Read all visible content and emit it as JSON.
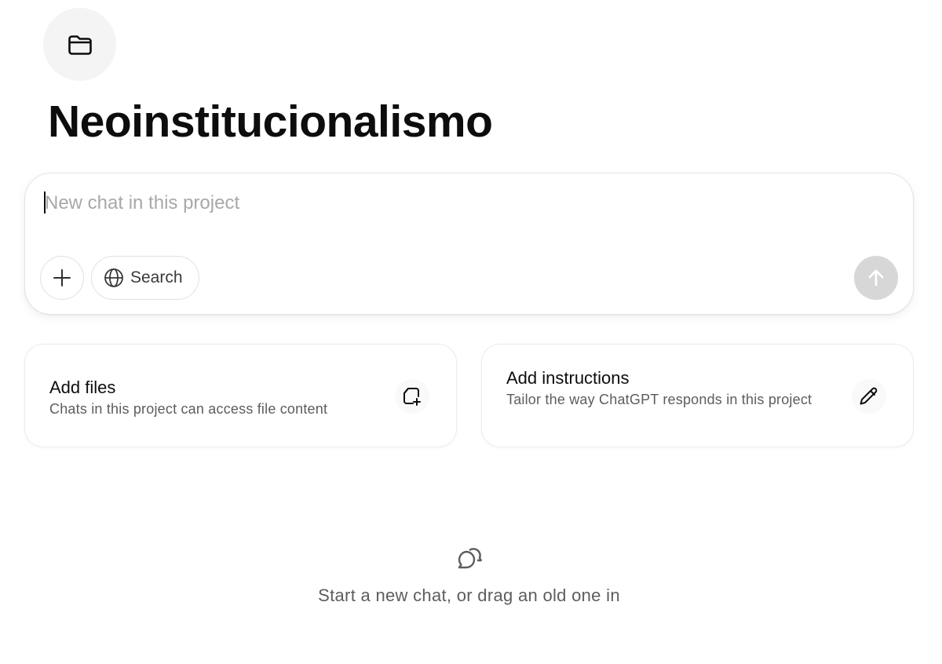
{
  "project": {
    "icon": "folder-icon",
    "title": "Neoinstitucionalismo"
  },
  "composer": {
    "placeholder": "New chat in this project",
    "value": "",
    "plus_icon": "plus-icon",
    "search_label": "Search",
    "search_icon": "globe-icon",
    "send_icon": "arrow-up-icon"
  },
  "cards": {
    "files": {
      "title": "Add files",
      "description": "Chats in this project can access file content",
      "icon": "file-plus-icon"
    },
    "instructions": {
      "title": "Add instructions",
      "description": "Tailor the way ChatGPT responds in this project",
      "icon": "pencil-icon"
    }
  },
  "empty_state": {
    "icon": "chat-bubbles-icon",
    "text": "Start a new chat, or drag an old one in"
  },
  "colors": {
    "send_disabled": "#d7d7d7",
    "text_primary": "#0d0d0d",
    "text_secondary": "#5d5d5d",
    "placeholder": "#a8a8a8"
  }
}
